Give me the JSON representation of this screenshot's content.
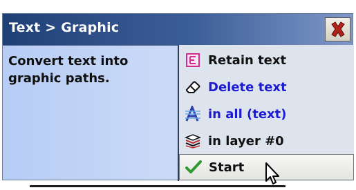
{
  "dialog": {
    "title": "Text > Graphic",
    "description": "Convert text into\ngraphic paths."
  },
  "menu": {
    "items": [
      {
        "label": "Retain text",
        "icon": "e-box-icon"
      },
      {
        "label": "Delete text",
        "icon": "eraser-icon"
      },
      {
        "label": "in all (text)",
        "icon": "text-a-icon"
      },
      {
        "label": "in layer #0",
        "icon": "layers-icon"
      },
      {
        "label": "Start",
        "icon": "checkmark-icon"
      }
    ]
  },
  "colors": {
    "title_bar_start": "#1f3f77",
    "title_bar_end": "#7e98c8",
    "close_x": "#b0221a",
    "link_blue": "#1b1bd2",
    "check_green": "#2f9a2f"
  }
}
